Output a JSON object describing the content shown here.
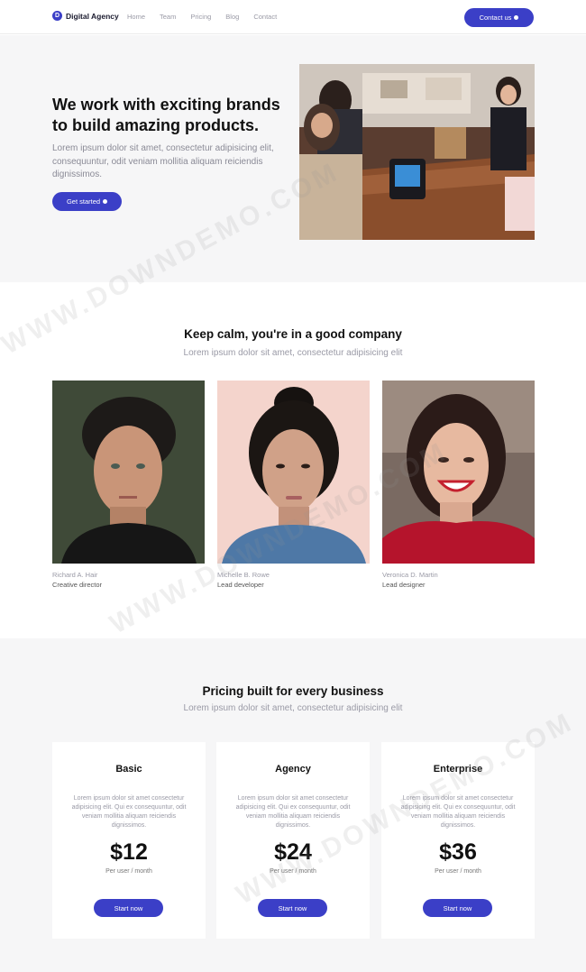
{
  "nav": {
    "brand_initial": "D",
    "brand_name": "Digital Agency",
    "links": [
      "Home",
      "Team",
      "Pricing",
      "Blog",
      "Contact"
    ],
    "contact_label": "Contact us"
  },
  "hero": {
    "title": "We work with exciting brands to build amazing products.",
    "description": "Lorem ipsum dolor sit amet, consectetur adipisicing elit, consequuntur, odit veniam mollitia aliquam reiciendis dignissimos.",
    "button_label": "Get started"
  },
  "team": {
    "title": "Keep calm, you're in a good company",
    "subtitle": "Lorem ipsum dolor sit amet, consectetur adipisicing elit",
    "members": [
      {
        "name": "Richard A. Hair",
        "role": "Creative director"
      },
      {
        "name": "Michelle B. Rowe",
        "role": "Lead developer"
      },
      {
        "name": "Veronica D. Martin",
        "role": "Lead designer"
      }
    ]
  },
  "pricing": {
    "title": "Pricing built for every business",
    "subtitle": "Lorem ipsum dolor sit amet, consectetur adipisicing elit",
    "plans": [
      {
        "name": "Basic",
        "description": "Lorem ipsum dolor sit amet consectetur adipisicing elit. Qui ex consequuntur, odit veniam mollitia aliquam reiciendis dignissimos.",
        "price": "$12",
        "period": "Per user / month",
        "button": "Start now"
      },
      {
        "name": "Agency",
        "description": "Lorem ipsum dolor sit amet consectetur adipisicing elit. Qui ex consequuntur, odit veniam mollitia aliquam reiciendis dignissimos.",
        "price": "$24",
        "period": "Per user / month",
        "button": "Start now"
      },
      {
        "name": "Enterprise",
        "description": "Lorem ipsum dolor sit amet consectetur adipisicing elit. Qui ex consequuntur, odit veniam mollitia aliquam reiciendis dignissimos.",
        "price": "$36",
        "period": "Per user / month",
        "button": "Start now"
      }
    ]
  },
  "watermark": "WWW.DOWNDEMO.COM",
  "colors": {
    "accent": "#3b3fc7",
    "hero_bg": "#f6f6f7",
    "muted_text": "#9a9aa6"
  }
}
